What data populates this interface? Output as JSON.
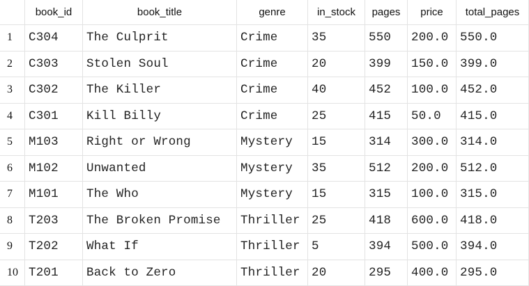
{
  "columns": [
    "book_id",
    "book_title",
    "genre",
    "in_stock",
    "pages",
    "price",
    "total_pages"
  ],
  "rows": [
    {
      "num": "1",
      "cells": [
        "C304",
        "The Culprit",
        "Crime",
        "35",
        "550",
        "200.0",
        "550.0"
      ]
    },
    {
      "num": "2",
      "cells": [
        "C303",
        "Stolen Soul",
        "Crime",
        "20",
        "399",
        "150.0",
        "399.0"
      ]
    },
    {
      "num": "3",
      "cells": [
        "C302",
        "The Killer",
        "Crime",
        "40",
        "452",
        "100.0",
        "452.0"
      ]
    },
    {
      "num": "4",
      "cells": [
        "C301",
        "Kill Billy",
        "Crime",
        "25",
        "415",
        "50.0",
        "415.0"
      ]
    },
    {
      "num": "5",
      "cells": [
        "M103",
        "Right or Wrong",
        "Mystery",
        "15",
        "314",
        "300.0",
        "314.0"
      ]
    },
    {
      "num": "6",
      "cells": [
        "M102",
        "Unwanted",
        "Mystery",
        "35",
        "512",
        "200.0",
        "512.0"
      ]
    },
    {
      "num": "7",
      "cells": [
        "M101",
        "The Who",
        "Mystery",
        "15",
        "315",
        "100.0",
        "315.0"
      ]
    },
    {
      "num": "8",
      "cells": [
        "T203",
        "The Broken Promise",
        "Thriller",
        "25",
        "418",
        "600.0",
        "418.0"
      ]
    },
    {
      "num": "9",
      "cells": [
        "T202",
        "What If",
        "Thriller",
        "5",
        "394",
        "500.0",
        "394.0"
      ]
    },
    {
      "num": "10",
      "cells": [
        "T201",
        "Back to Zero",
        "Thriller",
        "20",
        "295",
        "400.0",
        "295.0"
      ]
    }
  ]
}
